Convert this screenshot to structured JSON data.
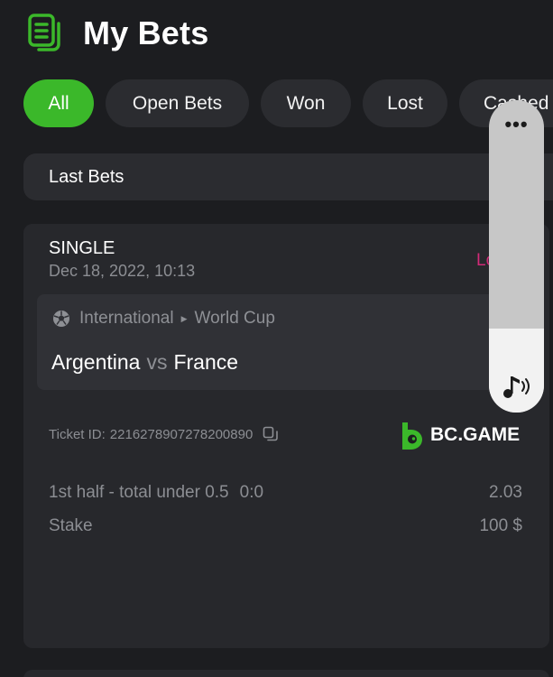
{
  "header": {
    "title": "My Bets",
    "icon": "bets-list-icon"
  },
  "tabs": [
    {
      "label": "All",
      "active": true
    },
    {
      "label": "Open Bets",
      "active": false
    },
    {
      "label": "Won",
      "active": false
    },
    {
      "label": "Lost",
      "active": false
    },
    {
      "label": "Cashed",
      "active": false
    }
  ],
  "section": {
    "label": "Last Bets"
  },
  "bet": {
    "type": "SINGLE",
    "date": "Dec 18, 2022, 10:13",
    "status": "Lost",
    "league": {
      "sport_icon": "soccer-ball-icon",
      "category": "International",
      "competition": "World Cup"
    },
    "match": {
      "home": "Argentina",
      "vs": "vs",
      "away": "France"
    },
    "ticket": {
      "label": "Ticket ID:",
      "id": "2216278907278200890"
    },
    "brand": "BC.GAME",
    "selection": {
      "market": "1st half - total under 0.5",
      "pick": "0:0",
      "odds": "2.03"
    },
    "stake": {
      "label": "Stake",
      "value": "100 $"
    }
  },
  "overlay": {
    "more_icon": "more-icon",
    "music_icon": "music-note-icon",
    "level": 0.27
  },
  "colors": {
    "background": "#1c1d20",
    "card": "#27282c",
    "accent": "#3bb82a",
    "lost": "#d22a78",
    "muted": "#8c8e93"
  }
}
